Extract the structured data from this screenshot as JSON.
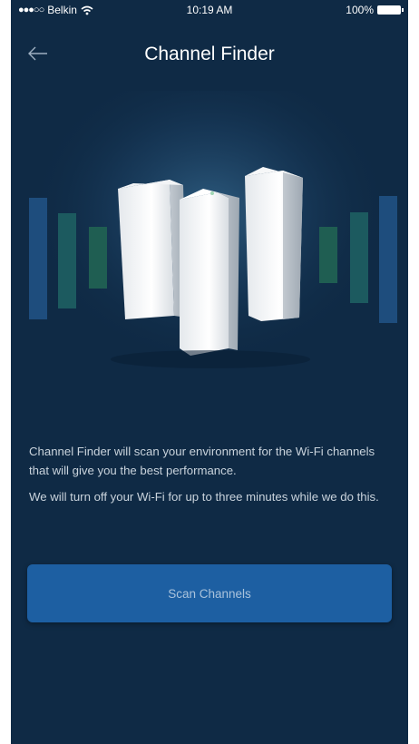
{
  "status_bar": {
    "carrier": "Belkin",
    "time": "10:19 AM",
    "battery": "100%",
    "icons": [
      "signal-dots-icon",
      "wifi-icon",
      "battery-icon"
    ]
  },
  "header": {
    "back_icon": "arrow-left-icon",
    "title": "Channel Finder"
  },
  "body": {
    "description_1": "Channel Finder will scan your environment for the Wi-Fi channels that will give you the best performance.",
    "description_2": "We will turn off your Wi-Fi for up to three minutes while we do this."
  },
  "actions": {
    "scan_label": "Scan Channels"
  },
  "colors": {
    "background": "#0f2a45",
    "button": "#1d5fa2",
    "button_text": "#aac3dc"
  }
}
